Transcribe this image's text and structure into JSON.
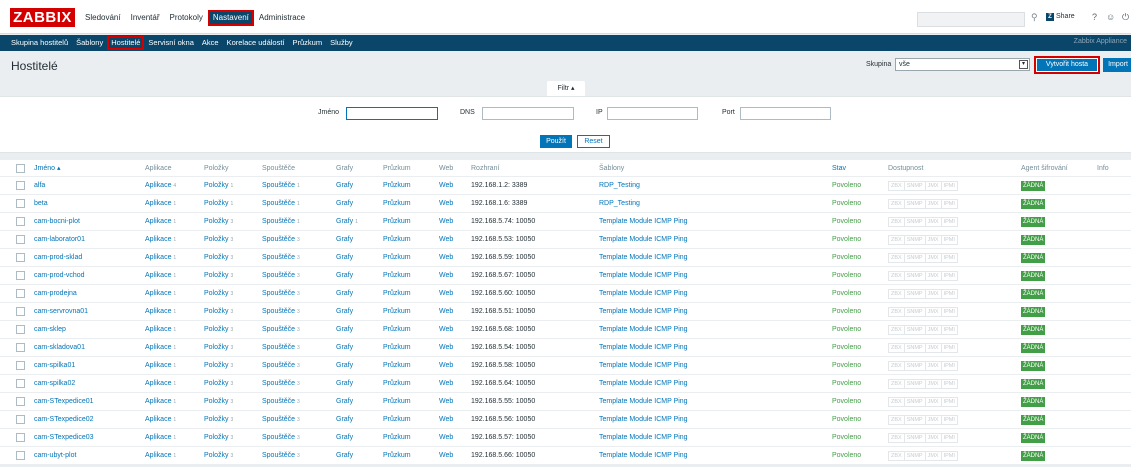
{
  "top_menu": {
    "logo": "ZABBIX",
    "items": [
      "Sledování",
      "Inventář",
      "Protokoly",
      "Nastavení",
      "Administrace"
    ],
    "share_label": "Share",
    "help_label": "?"
  },
  "sub_menu": {
    "items": [
      "Skupina hostitelů",
      "Šablony",
      "Hostitelé",
      "Servisní okna",
      "Akce",
      "Korelace událostí",
      "Průzkum",
      "Služby"
    ],
    "app_name": "Zabbix Appliance"
  },
  "header": {
    "title": "Hostitelé",
    "group_label": "Skupina",
    "group_value": "vše",
    "create_button": "Vytvořit hosta",
    "import_button": "Import"
  },
  "filter": {
    "tab_label": "Filtr ▴",
    "name_label": "Jméno",
    "dns_label": "DNS",
    "ip_label": "IP",
    "port_label": "Port",
    "apply_button": "Použít",
    "reset_button": "Reset"
  },
  "table": {
    "columns": [
      "Jméno ▴",
      "Aplikace",
      "Položky",
      "Spouštěče",
      "Grafy",
      "Průzkum",
      "Web",
      "Rozhraní",
      "Šablony",
      "Stav",
      "Dostupnost",
      "Agent šifrování",
      "Info"
    ],
    "availability": [
      "ZBX",
      "SNMP",
      "JMX",
      "IPMI"
    ],
    "encryption": "ŽÁDNÁ",
    "rows": [
      {
        "name": "alfa",
        "apps": "Aplikace",
        "apps_n": "4",
        "items": "Položky",
        "items_n": "1",
        "triggers": "Spouštěče",
        "triggers_n": "1",
        "graphs": "Grafy",
        "graphs_n": "",
        "discovery": "Průzkum",
        "web": "Web",
        "iface": "192.168.1.2: 3389",
        "template": "RDP_Testing",
        "status": "Povoleno"
      },
      {
        "name": "beta",
        "apps": "Aplikace",
        "apps_n": "1",
        "items": "Položky",
        "items_n": "1",
        "triggers": "Spouštěče",
        "triggers_n": "1",
        "graphs": "Grafy",
        "graphs_n": "",
        "discovery": "Průzkum",
        "web": "Web",
        "iface": "192.168.1.6: 3389",
        "template": "RDP_Testing",
        "status": "Povoleno"
      },
      {
        "name": "cam-bocni-plot",
        "apps": "Aplikace",
        "apps_n": "1",
        "items": "Položky",
        "items_n": "3",
        "triggers": "Spouštěče",
        "triggers_n": "1",
        "graphs": "Grafy",
        "graphs_n": "1",
        "discovery": "Průzkum",
        "web": "Web",
        "iface": "192.168.5.74: 10050",
        "template": "Template Module ICMP Ping",
        "status": "Povoleno"
      },
      {
        "name": "cam-laborator01",
        "apps": "Aplikace",
        "apps_n": "1",
        "items": "Položky",
        "items_n": "3",
        "triggers": "Spouštěče",
        "triggers_n": "3",
        "graphs": "Grafy",
        "graphs_n": "",
        "discovery": "Průzkum",
        "web": "Web",
        "iface": "192.168.5.53: 10050",
        "template": "Template Module ICMP Ping",
        "status": "Povoleno"
      },
      {
        "name": "cam-prod-sklad",
        "apps": "Aplikace",
        "apps_n": "1",
        "items": "Položky",
        "items_n": "3",
        "triggers": "Spouštěče",
        "triggers_n": "3",
        "graphs": "Grafy",
        "graphs_n": "",
        "discovery": "Průzkum",
        "web": "Web",
        "iface": "192.168.5.59: 10050",
        "template": "Template Module ICMP Ping",
        "status": "Povoleno"
      },
      {
        "name": "cam-prod-vchod",
        "apps": "Aplikace",
        "apps_n": "1",
        "items": "Položky",
        "items_n": "3",
        "triggers": "Spouštěče",
        "triggers_n": "3",
        "graphs": "Grafy",
        "graphs_n": "",
        "discovery": "Průzkum",
        "web": "Web",
        "iface": "192.168.5.67: 10050",
        "template": "Template Module ICMP Ping",
        "status": "Povoleno"
      },
      {
        "name": "cam-prodejna",
        "apps": "Aplikace",
        "apps_n": "1",
        "items": "Položky",
        "items_n": "3",
        "triggers": "Spouštěče",
        "triggers_n": "3",
        "graphs": "Grafy",
        "graphs_n": "",
        "discovery": "Průzkum",
        "web": "Web",
        "iface": "192.168.5.60: 10050",
        "template": "Template Module ICMP Ping",
        "status": "Povoleno"
      },
      {
        "name": "cam-servrovna01",
        "apps": "Aplikace",
        "apps_n": "1",
        "items": "Položky",
        "items_n": "3",
        "triggers": "Spouštěče",
        "triggers_n": "3",
        "graphs": "Grafy",
        "graphs_n": "",
        "discovery": "Průzkum",
        "web": "Web",
        "iface": "192.168.5.51: 10050",
        "template": "Template Module ICMP Ping",
        "status": "Povoleno"
      },
      {
        "name": "cam-sklep",
        "apps": "Aplikace",
        "apps_n": "1",
        "items": "Položky",
        "items_n": "3",
        "triggers": "Spouštěče",
        "triggers_n": "3",
        "graphs": "Grafy",
        "graphs_n": "",
        "discovery": "Průzkum",
        "web": "Web",
        "iface": "192.168.5.68: 10050",
        "template": "Template Module ICMP Ping",
        "status": "Povoleno"
      },
      {
        "name": "cam-skladova01",
        "apps": "Aplikace",
        "apps_n": "1",
        "items": "Položky",
        "items_n": "3",
        "triggers": "Spouštěče",
        "triggers_n": "3",
        "graphs": "Grafy",
        "graphs_n": "",
        "discovery": "Průzkum",
        "web": "Web",
        "iface": "192.168.5.54: 10050",
        "template": "Template Module ICMP Ping",
        "status": "Povoleno"
      },
      {
        "name": "cam-spilka01",
        "apps": "Aplikace",
        "apps_n": "1",
        "items": "Položky",
        "items_n": "3",
        "triggers": "Spouštěče",
        "triggers_n": "3",
        "graphs": "Grafy",
        "graphs_n": "",
        "discovery": "Průzkum",
        "web": "Web",
        "iface": "192.168.5.58: 10050",
        "template": "Template Module ICMP Ping",
        "status": "Povoleno"
      },
      {
        "name": "cam-spilka02",
        "apps": "Aplikace",
        "apps_n": "1",
        "items": "Položky",
        "items_n": "3",
        "triggers": "Spouštěče",
        "triggers_n": "3",
        "graphs": "Grafy",
        "graphs_n": "",
        "discovery": "Průzkum",
        "web": "Web",
        "iface": "192.168.5.64: 10050",
        "template": "Template Module ICMP Ping",
        "status": "Povoleno"
      },
      {
        "name": "cam-STexpedice01",
        "apps": "Aplikace",
        "apps_n": "1",
        "items": "Položky",
        "items_n": "3",
        "triggers": "Spouštěče",
        "triggers_n": "3",
        "graphs": "Grafy",
        "graphs_n": "",
        "discovery": "Průzkum",
        "web": "Web",
        "iface": "192.168.5.55: 10050",
        "template": "Template Module ICMP Ping",
        "status": "Povoleno"
      },
      {
        "name": "cam-STexpedice02",
        "apps": "Aplikace",
        "apps_n": "1",
        "items": "Položky",
        "items_n": "3",
        "triggers": "Spouštěče",
        "triggers_n": "3",
        "graphs": "Grafy",
        "graphs_n": "",
        "discovery": "Průzkum",
        "web": "Web",
        "iface": "192.168.5.56: 10050",
        "template": "Template Module ICMP Ping",
        "status": "Povoleno"
      },
      {
        "name": "cam-STexpedice03",
        "apps": "Aplikace",
        "apps_n": "1",
        "items": "Položky",
        "items_n": "3",
        "triggers": "Spouštěče",
        "triggers_n": "3",
        "graphs": "Grafy",
        "graphs_n": "",
        "discovery": "Průzkum",
        "web": "Web",
        "iface": "192.168.5.57: 10050",
        "template": "Template Module ICMP Ping",
        "status": "Povoleno"
      },
      {
        "name": "cam-ubyt-plot",
        "apps": "Aplikace",
        "apps_n": "1",
        "items": "Položky",
        "items_n": "3",
        "triggers": "Spouštěče",
        "triggers_n": "3",
        "graphs": "Grafy",
        "graphs_n": "",
        "discovery": "Průzkum",
        "web": "Web",
        "iface": "192.168.5.66: 10050",
        "template": "Template Module ICMP Ping",
        "status": "Povoleno"
      }
    ]
  }
}
